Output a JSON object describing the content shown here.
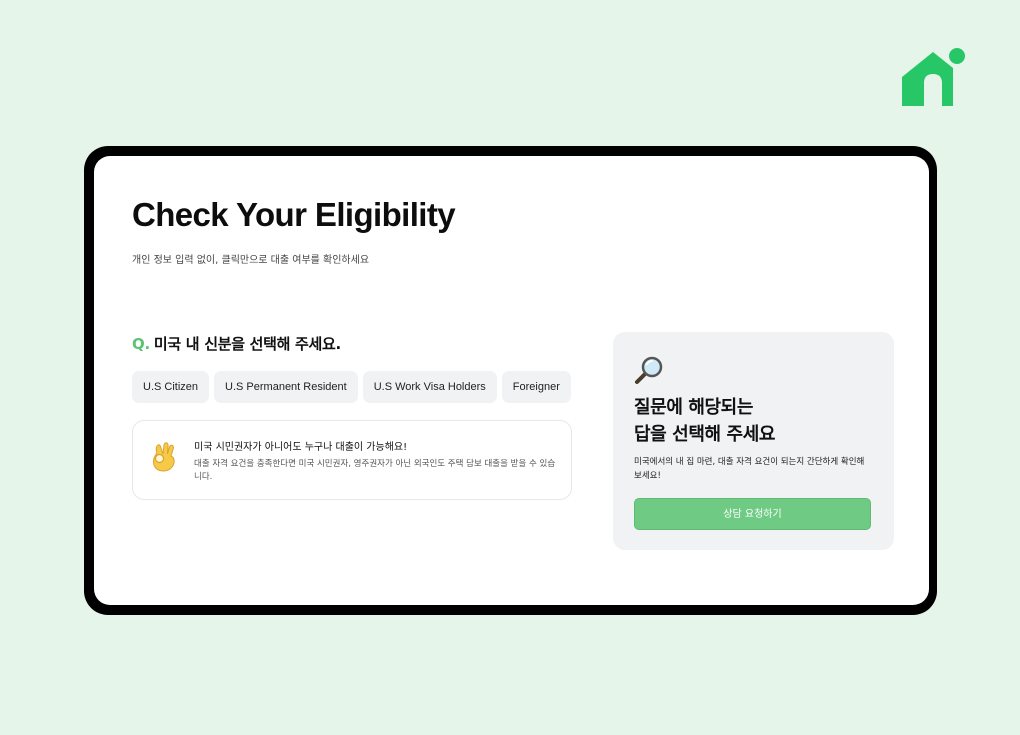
{
  "brand": {
    "logo_icon": "house-icon",
    "accent_color": "#27c768"
  },
  "main": {
    "title": "Check Your Eligibility",
    "subtitle": "개인 정보 입력 없이, 클릭만으로 대출 여부를 확인하세요"
  },
  "question": {
    "prefix": "Q.",
    "text": "미국 내 신분을 선택해 주세요.",
    "options": [
      "U.S Citizen",
      "U.S Permanent Resident",
      "U.S Work Visa Holders",
      "Foreigner"
    ]
  },
  "info": {
    "icon": "ok-hand-emoji-icon",
    "title": "미국 시민권자가 아니어도 누구나 대출이 가능해요!",
    "body": "대출 자격 요건을 충족한다면 미국 시민권자, 영주권자가 아닌 외국인도 주택 담보 대출을 받을 수 있습니다."
  },
  "side": {
    "icon": "magnifier-icon",
    "heading_line1": "질문에 해당되는",
    "heading_line2": "답을 선택해 주세요",
    "description": "미국에서의 내 집 마련, 대출 자격 요건이 되는지 간단하게 확인해 보세요!",
    "cta_label": "상담 요청하기",
    "cta_color": "#6fcb84"
  }
}
